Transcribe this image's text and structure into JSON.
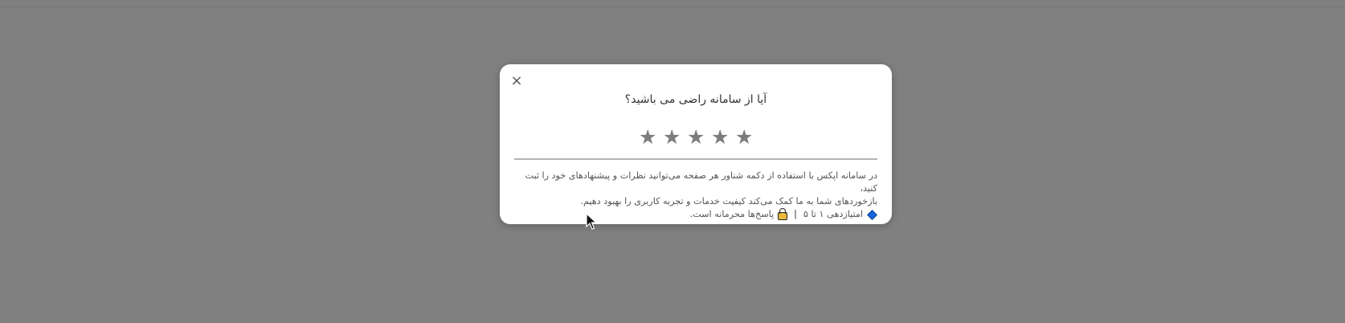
{
  "modal": {
    "close_label": "×",
    "title": "آیا از سامانه راضی می باشید؟",
    "stars": [
      "★",
      "★",
      "★",
      "★",
      "★"
    ],
    "description_line1": "در سامانه اپکس با استفاده از دکمه شناور هر صفحه می‌توانید نظرات و پیشنهادهای خود را ثبت کنید،",
    "description_line2": "بازخوردهای شما به ما کمک می‌کند کیفیت خدمات و تجربه کاربری را بهبود دهیم.",
    "info_rating": "امتیازدهی ۱ تا ۵",
    "info_separator": "|",
    "info_privacy": "پاسخ‌ها محرمانه است."
  },
  "icons": {
    "close": "close-icon",
    "star": "star-icon",
    "diamond": "blue-diamond-icon",
    "lock": "lock-icon",
    "cursor": "mouse-cursor-icon"
  },
  "colors": {
    "overlay": "#808080",
    "modal_bg": "#ffffff",
    "star": "#7c7c7c",
    "diamond": "#1565e0",
    "lock": "#e8b93a"
  }
}
